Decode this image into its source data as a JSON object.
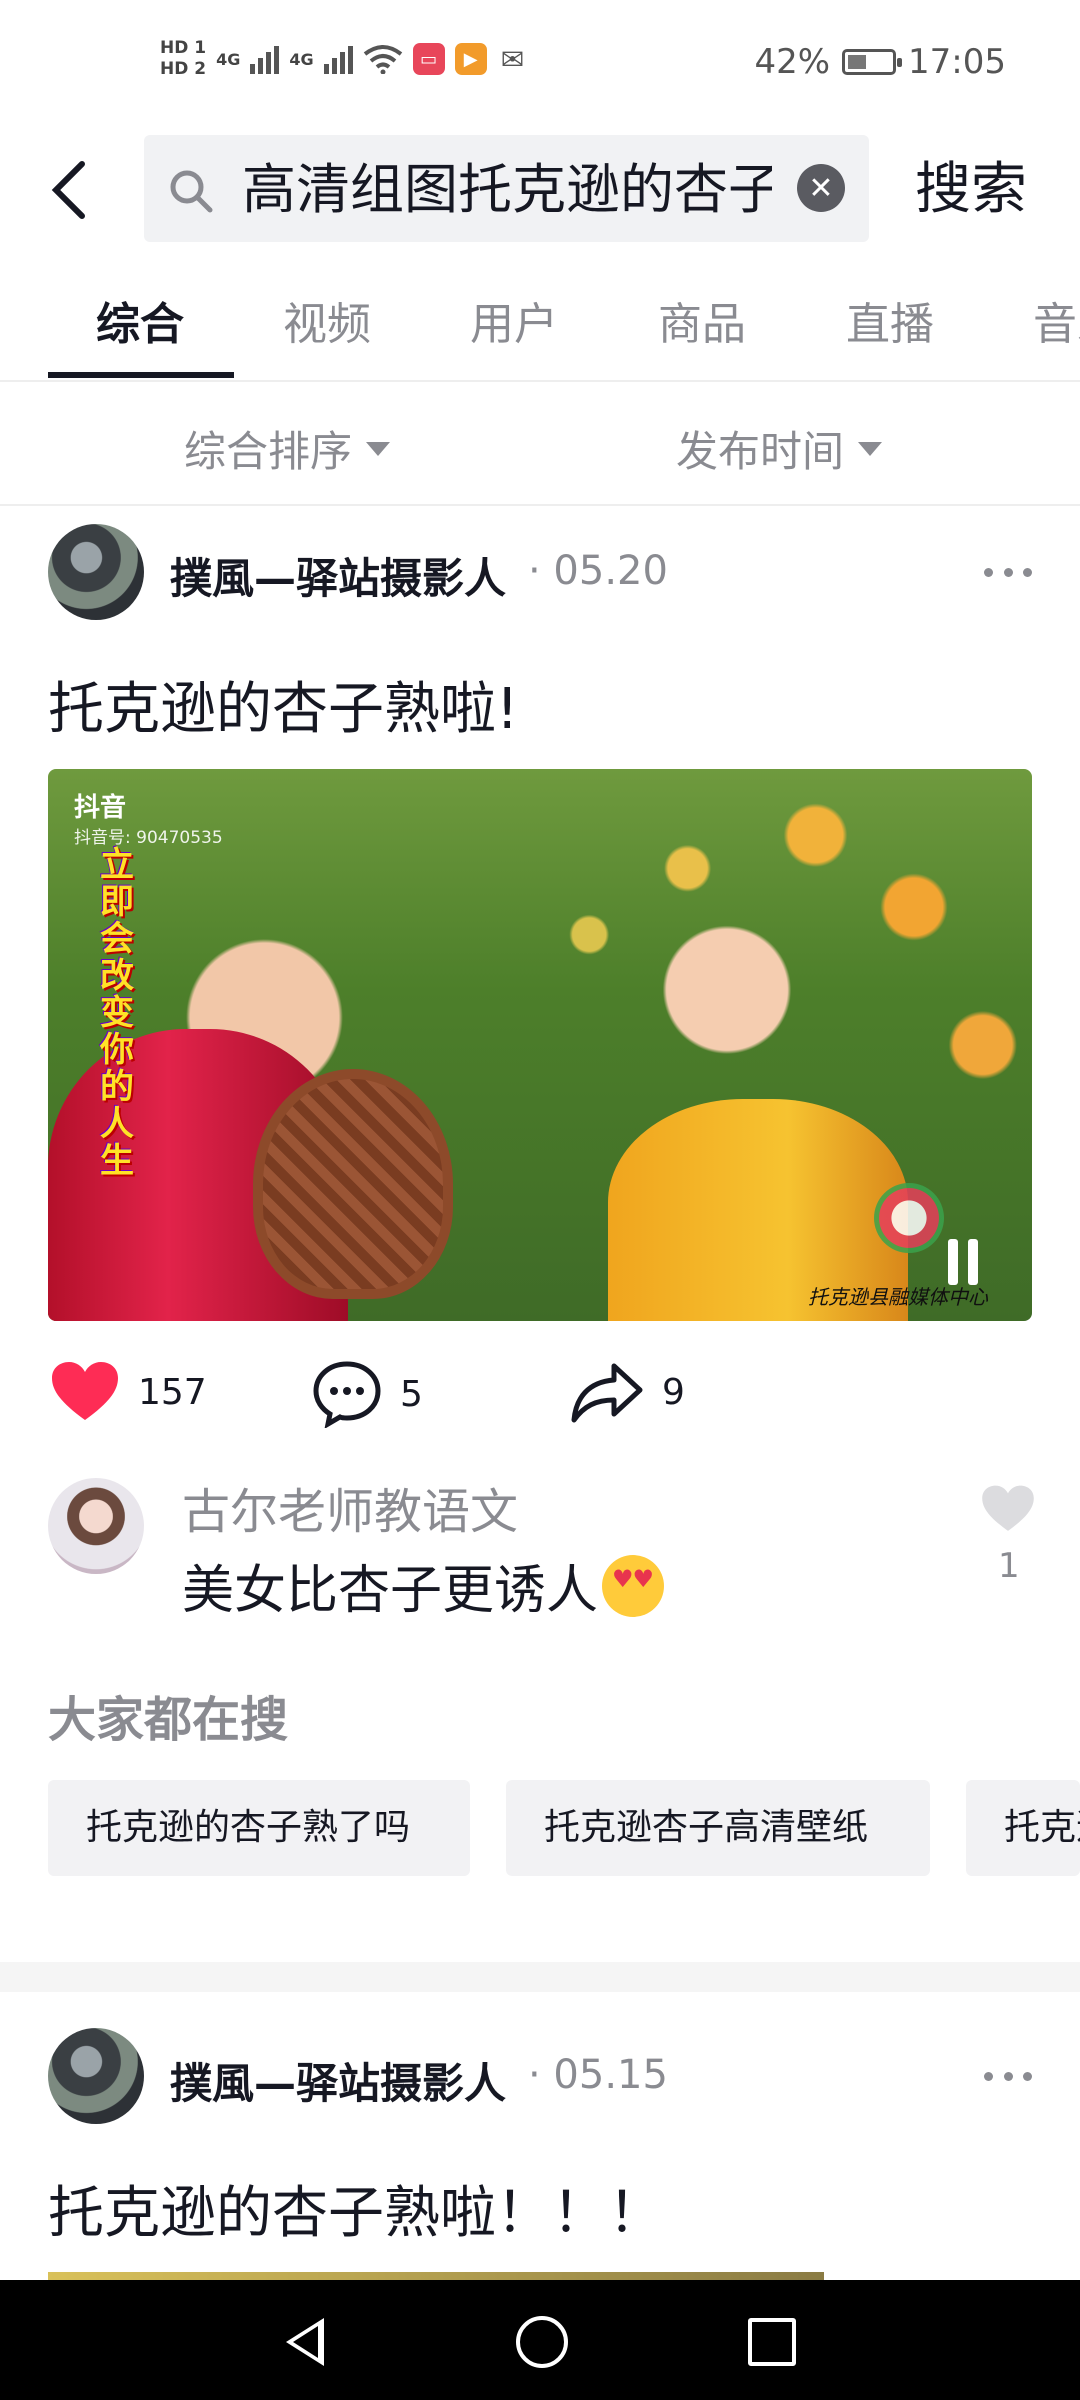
{
  "status_bar": {
    "hd1": "HD 1",
    "hd2": "HD 2",
    "net1": "4G",
    "net2": "4G",
    "battery_percent": "42%",
    "battery_level": 0.42,
    "time": "17:05"
  },
  "search": {
    "query": "高清组图托克逊的杏子",
    "button_label": "搜索"
  },
  "tabs": [
    {
      "label": "综合",
      "active": true
    },
    {
      "label": "视频",
      "active": false
    },
    {
      "label": "用户",
      "active": false
    },
    {
      "label": "商品",
      "active": false
    },
    {
      "label": "直播",
      "active": false
    },
    {
      "label": "音乐",
      "active": false
    }
  ],
  "filters": {
    "sort_label": "综合排序",
    "time_label": "发布时间"
  },
  "posts": [
    {
      "author": "撲風—驿站摄影人",
      "date": "· 05.20",
      "title": "托克逊的杏子熟啦!",
      "video": {
        "watermark_app": "抖音",
        "watermark_id": "抖音号: 90470535",
        "overlay_text": "立即会改变你的人生",
        "caption": "托克逊县融媒体中心"
      },
      "likes": "157",
      "comments": "5",
      "shares": "9",
      "top_comment": {
        "user": "古尔老师教语文",
        "text": "美女比杏子更诱人",
        "likes": "1"
      }
    },
    {
      "author": "撲風—驿站摄影人",
      "date": "· 05.15",
      "title": "托克逊的杏子熟啦！！！"
    }
  ],
  "everyone_search": {
    "title": "大家都在搜",
    "chips": [
      "托克逊的杏子熟了吗",
      "托克逊杏子高清壁纸",
      "托克逊杏子"
    ]
  },
  "colors": {
    "like_red": "#fe2c55",
    "text_primary": "#161823",
    "text_secondary": "#8a8b91"
  }
}
